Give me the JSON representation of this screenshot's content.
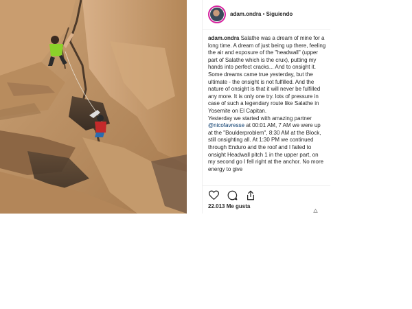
{
  "post": {
    "image_alt": "climber on granite wall",
    "username": "adam.ondra",
    "separator": "•",
    "follow_label": "Siguiendo",
    "caption_user": "adam.ondra",
    "caption_part1": "Salathe was a dream of mine for a long time. A dream of just being up there, feeling the air and exposure of the \"headwall\" (upper part of Salathe which is the crux), putting my hands into perfect cracks... And to onsight it. Some dreams came true yesterday, but the ultimate - the onsight is not fulfilled. And the nature of onsight is that it will never be fulfilled any more. It is only one try.  lots of pressure in case of such a legendary route like Salathe in Yosemite on El Capitan.",
    "caption_part2": "Yesterday we started with amazing partner ",
    "caption_mention": "@nicofavresse",
    "caption_part3": " at 00:01 AM, 7 AM we were up at the \"Boulderproblem\", 8:30 AM at the Block, still onsighting all. At 1:30 PM we continued through Enduro and the roof and I failed to onsight Headwall pitch 1 in the upper part, on my second go I fell right at the anchor. No more energy to give",
    "likes_text": "22.013 Me gusta"
  },
  "icons": {
    "like": "heart-icon",
    "comment": "comment-icon",
    "share": "share-icon",
    "more": "triangle-icon"
  },
  "colors": {
    "avatar_ring": "#d6249f",
    "mention": "#003569",
    "text": "#262626"
  }
}
